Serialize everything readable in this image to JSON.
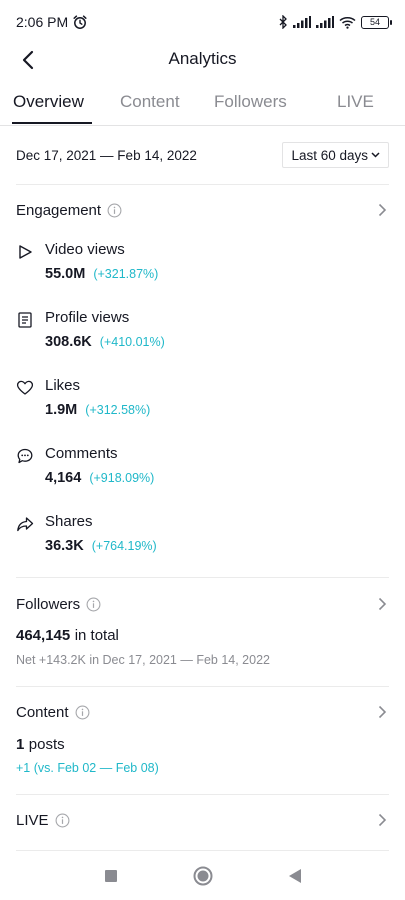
{
  "status_bar": {
    "time": "2:06 PM",
    "battery": "54"
  },
  "header": {
    "title": "Analytics"
  },
  "tabs": [
    {
      "label": "Overview",
      "active": true
    },
    {
      "label": "Content"
    },
    {
      "label": "Followers"
    },
    {
      "label": "LIVE"
    }
  ],
  "date_filter": {
    "range": "Dec 17, 2021 — Feb 14, 2022",
    "selected": "Last 60 days"
  },
  "engagement": {
    "title": "Engagement",
    "items": [
      {
        "icon": "play-icon",
        "label": "Video views",
        "value": "55.0M",
        "change": "(+321.87%)"
      },
      {
        "icon": "document-icon",
        "label": "Profile views",
        "value": "308.6K",
        "change": "(+410.01%)"
      },
      {
        "icon": "heart-icon",
        "label": "Likes",
        "value": "1.9M",
        "change": "(+312.58%)"
      },
      {
        "icon": "comment-icon",
        "label": "Comments",
        "value": "4,164",
        "change": "(+918.09%)"
      },
      {
        "icon": "share-icon",
        "label": "Shares",
        "value": "36.3K",
        "change": "(+764.19%)"
      }
    ]
  },
  "followers": {
    "title": "Followers",
    "total": "464,145",
    "total_suffix": "in total",
    "net": "Net +143.2K in Dec 17, 2021 — Feb 14, 2022"
  },
  "content": {
    "title": "Content",
    "count": "1",
    "count_suffix": "posts",
    "comparison": "+1 (vs. Feb 02 — Feb 08)"
  },
  "live": {
    "title": "LIVE"
  },
  "colors": {
    "accent_teal": "#20b8c9",
    "text": "#161823",
    "muted": "#8a8b91"
  }
}
